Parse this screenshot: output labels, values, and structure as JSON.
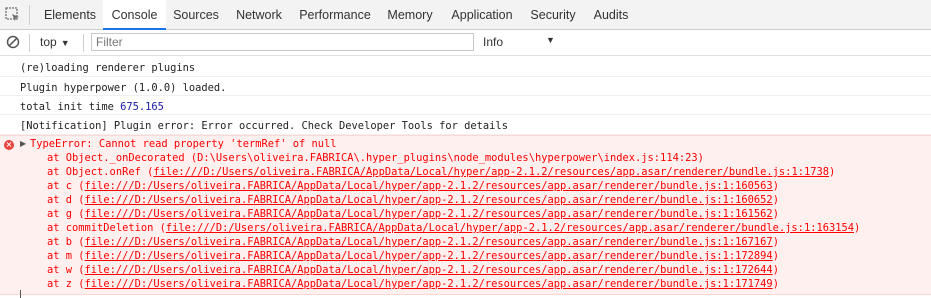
{
  "tabs": [
    {
      "label": "Elements",
      "active": false
    },
    {
      "label": "Console",
      "active": true
    },
    {
      "label": "Sources",
      "active": false
    },
    {
      "label": "Network",
      "active": false
    },
    {
      "label": "Performance",
      "active": false
    },
    {
      "label": "Memory",
      "active": false
    },
    {
      "label": "Application",
      "active": false
    },
    {
      "label": "Security",
      "active": false
    },
    {
      "label": "Audits",
      "active": false
    }
  ],
  "toolbar": {
    "context": "top",
    "filter_placeholder": "Filter",
    "levels": "Info"
  },
  "messages": [
    {
      "text": "(re)loading renderer plugins"
    },
    {
      "text": "Plugin hyperpower (1.0.0) loaded."
    },
    {
      "text_prefix": "total init time ",
      "number": "675.165"
    },
    {
      "text": "[Notification] Plugin error: Error occurred. Check Developer Tools for details"
    }
  ],
  "error": {
    "message": "TypeError: Cannot read property 'termRef' of null",
    "frames": [
      {
        "fn": "at Object._onDecorated (",
        "loc": "D:\\Users\\oliveira.FABRICA\\.hyper_plugins\\node_modules\\hyperpower\\index.js:114:23",
        "end": ")",
        "link": false
      },
      {
        "fn": "at Object.onRef (",
        "loc": "file:///D:/Users/oliveira.FABRICA/AppData/Local/hyper/app-2.1.2/resources/app.asar/renderer/bundle.js:1:1738",
        "end": ")",
        "link": true
      },
      {
        "fn": "at c (",
        "loc": "file:///D:/Users/oliveira.FABRICA/AppData/Local/hyper/app-2.1.2/resources/app.asar/renderer/bundle.js:1:160563",
        "end": ")",
        "link": true
      },
      {
        "fn": "at d (",
        "loc": "file:///D:/Users/oliveira.FABRICA/AppData/Local/hyper/app-2.1.2/resources/app.asar/renderer/bundle.js:1:160652",
        "end": ")",
        "link": true
      },
      {
        "fn": "at g (",
        "loc": "file:///D:/Users/oliveira.FABRICA/AppData/Local/hyper/app-2.1.2/resources/app.asar/renderer/bundle.js:1:161562",
        "end": ")",
        "link": true
      },
      {
        "fn": "at commitDeletion (",
        "loc": "file:///D:/Users/oliveira.FABRICA/AppData/Local/hyper/app-2.1.2/resources/app.asar/renderer/bundle.js:1:163154",
        "end": ")",
        "link": true
      },
      {
        "fn": "at b (",
        "loc": "file:///D:/Users/oliveira.FABRICA/AppData/Local/hyper/app-2.1.2/resources/app.asar/renderer/bundle.js:1:167167",
        "end": ")",
        "link": true
      },
      {
        "fn": "at m (",
        "loc": "file:///D:/Users/oliveira.FABRICA/AppData/Local/hyper/app-2.1.2/resources/app.asar/renderer/bundle.js:1:172894",
        "end": ")",
        "link": true
      },
      {
        "fn": "at w (",
        "loc": "file:///D:/Users/oliveira.FABRICA/AppData/Local/hyper/app-2.1.2/resources/app.asar/renderer/bundle.js:1:172644",
        "end": ")",
        "link": true
      },
      {
        "fn": "at z (",
        "loc": "file:///D:/Users/oliveira.FABRICA/AppData/Local/hyper/app-2.1.2/resources/app.asar/renderer/bundle.js:1:171749",
        "end": ")",
        "link": true
      }
    ]
  },
  "colors": {
    "accent": "#1a73e8",
    "error_text": "#ff0000",
    "error_bg": "#fff0f0",
    "number": "#1a1aa6"
  }
}
